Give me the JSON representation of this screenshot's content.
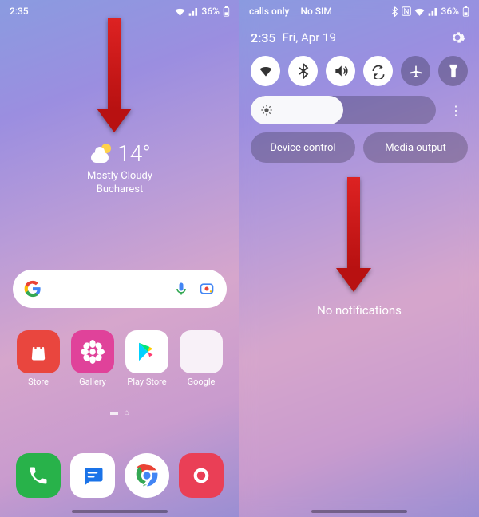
{
  "home": {
    "status": {
      "time": "2:35",
      "battery": "36%"
    },
    "weather": {
      "temp": "14°",
      "condition": "Mostly Cloudy",
      "location": "Bucharest"
    },
    "apps": {
      "store": "Store",
      "gallery": "Gallery",
      "play": "Play Store",
      "google": "Google"
    }
  },
  "panel": {
    "status": {
      "left1": "calls only",
      "left2": "No SIM",
      "battery": "36%"
    },
    "time": "2:35",
    "date": "Fri, Apr 19",
    "buttons": {
      "device": "Device control",
      "media": "Media output"
    },
    "no_notif": "No notifications"
  }
}
